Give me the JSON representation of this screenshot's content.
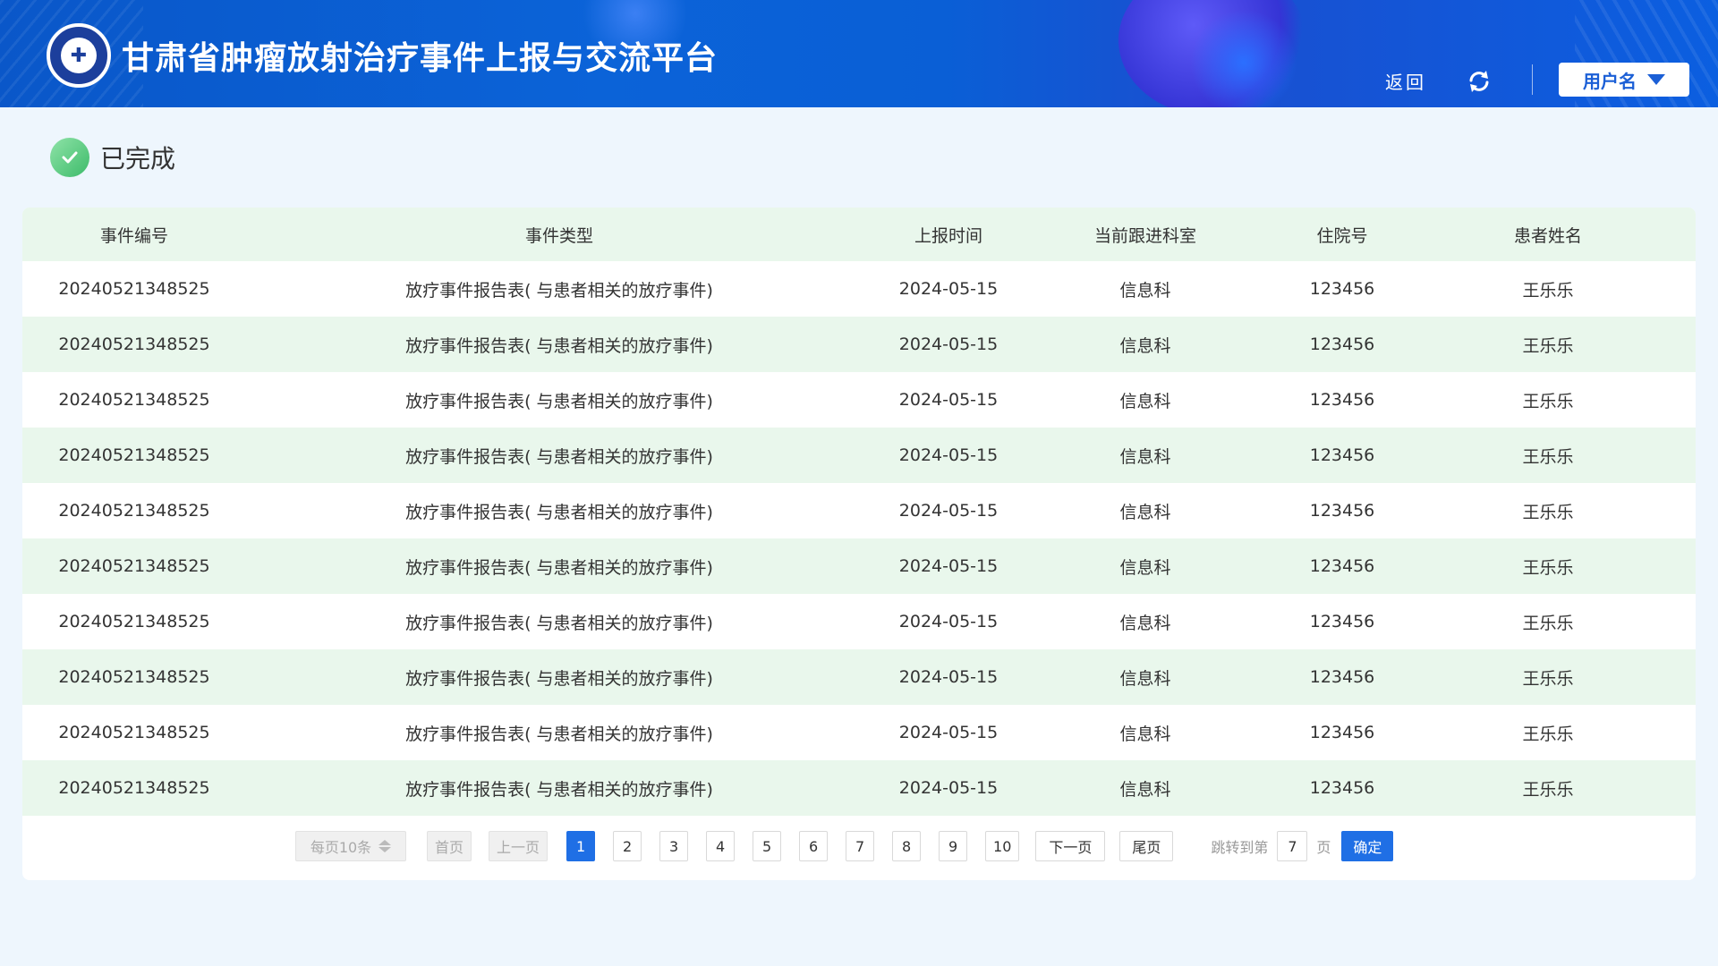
{
  "header": {
    "title": "甘肃省肿瘤放射治疗事件上报与交流平台",
    "back_label": "返回",
    "user_label": "用户名",
    "accent_color": "#0b63d8"
  },
  "status": {
    "label": "已完成",
    "color": "#3dbb6a"
  },
  "table": {
    "columns": [
      "事件编号",
      "事件类型",
      "上报时间",
      "当前跟进科室",
      "住院号",
      "患者姓名"
    ],
    "rows": [
      [
        "20240521348525",
        "放疗事件报告表( 与患者相关的放疗事件)",
        "2024-05-15",
        "信息科",
        "123456",
        "王乐乐"
      ],
      [
        "20240521348525",
        "放疗事件报告表( 与患者相关的放疗事件)",
        "2024-05-15",
        "信息科",
        "123456",
        "王乐乐"
      ],
      [
        "20240521348525",
        "放疗事件报告表( 与患者相关的放疗事件)",
        "2024-05-15",
        "信息科",
        "123456",
        "王乐乐"
      ],
      [
        "20240521348525",
        "放疗事件报告表( 与患者相关的放疗事件)",
        "2024-05-15",
        "信息科",
        "123456",
        "王乐乐"
      ],
      [
        "20240521348525",
        "放疗事件报告表( 与患者相关的放疗事件)",
        "2024-05-15",
        "信息科",
        "123456",
        "王乐乐"
      ],
      [
        "20240521348525",
        "放疗事件报告表( 与患者相关的放疗事件)",
        "2024-05-15",
        "信息科",
        "123456",
        "王乐乐"
      ],
      [
        "20240521348525",
        "放疗事件报告表( 与患者相关的放疗事件)",
        "2024-05-15",
        "信息科",
        "123456",
        "王乐乐"
      ],
      [
        "20240521348525",
        "放疗事件报告表( 与患者相关的放疗事件)",
        "2024-05-15",
        "信息科",
        "123456",
        "王乐乐"
      ],
      [
        "20240521348525",
        "放疗事件报告表( 与患者相关的放疗事件)",
        "2024-05-15",
        "信息科",
        "123456",
        "王乐乐"
      ],
      [
        "20240521348525",
        "放疗事件报告表( 与患者相关的放疗事件)",
        "2024-05-15",
        "信息科",
        "123456",
        "王乐乐"
      ]
    ]
  },
  "pagination": {
    "page_size_label": "每页10条",
    "first_label": "首页",
    "prev_label": "上一页",
    "pages": [
      "1",
      "2",
      "3",
      "4",
      "5",
      "6",
      "7",
      "8",
      "9",
      "10"
    ],
    "current_page": "1",
    "next_label": "下一页",
    "last_label": "尾页",
    "jump_label": "跳转到第",
    "jump_value": "7",
    "page_unit": "页",
    "confirm_label": "确定"
  }
}
